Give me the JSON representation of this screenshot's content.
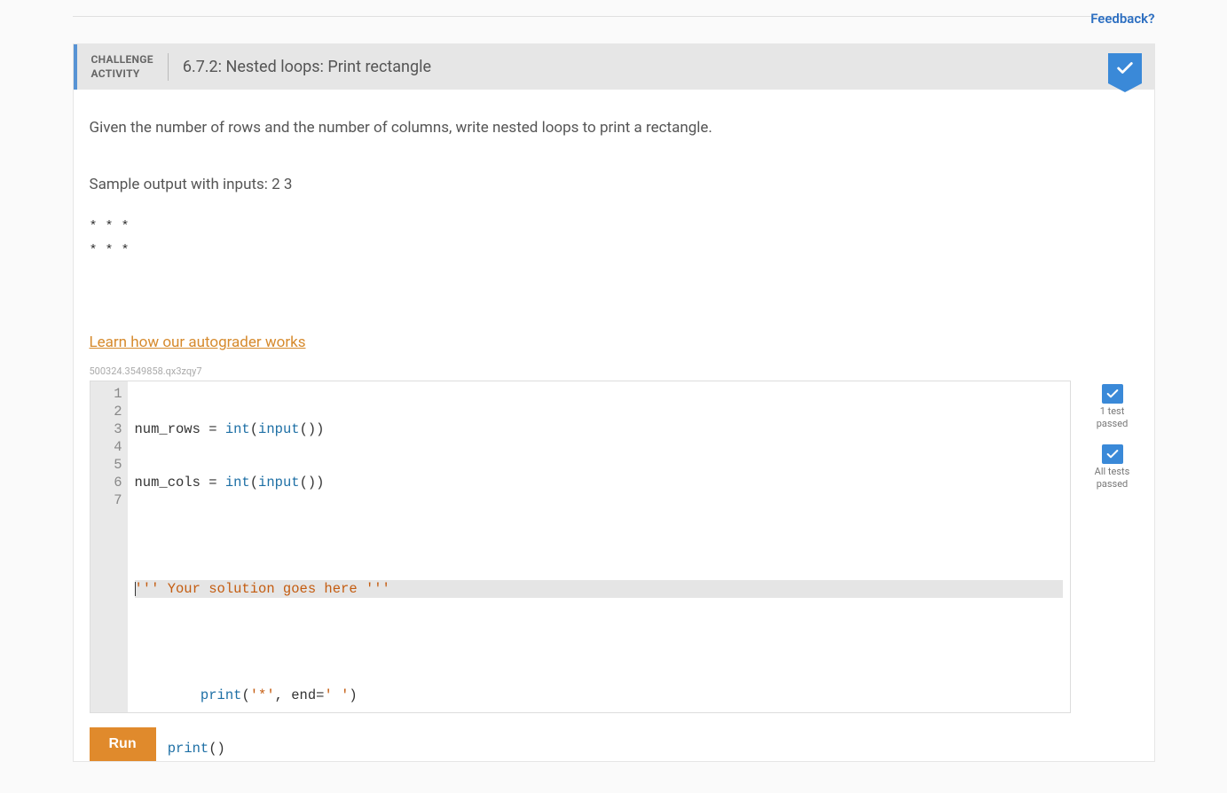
{
  "feedback_link": "Feedback?",
  "header": {
    "label_line1": "CHALLENGE",
    "label_line2": "ACTIVITY",
    "title": "6.7.2: Nested loops: Print rectangle"
  },
  "instructions": "Given the number of rows and the number of columns, write nested loops to print a rectangle.",
  "sample_label": "Sample output with inputs: 2 3",
  "sample_output": "* * * \n* * * ",
  "autograder_link": "Learn how our autograder works",
  "code_id": "500324.3549858.qx3zqy7",
  "code": {
    "lines": [
      {
        "n": "1",
        "text": "num_rows = int(input())"
      },
      {
        "n": "2",
        "text": "num_cols = int(input())"
      },
      {
        "n": "3",
        "text": ""
      },
      {
        "n": "4",
        "text": "''' Your solution goes here '''",
        "highlighted": true
      },
      {
        "n": "5",
        "text": ""
      },
      {
        "n": "6",
        "text": "        print('*', end=' ')"
      },
      {
        "n": "7",
        "text": "    print()"
      }
    ]
  },
  "status": {
    "test1_label": "1 test\npassed",
    "all_label": "All tests\npassed"
  },
  "run_button": "Run"
}
